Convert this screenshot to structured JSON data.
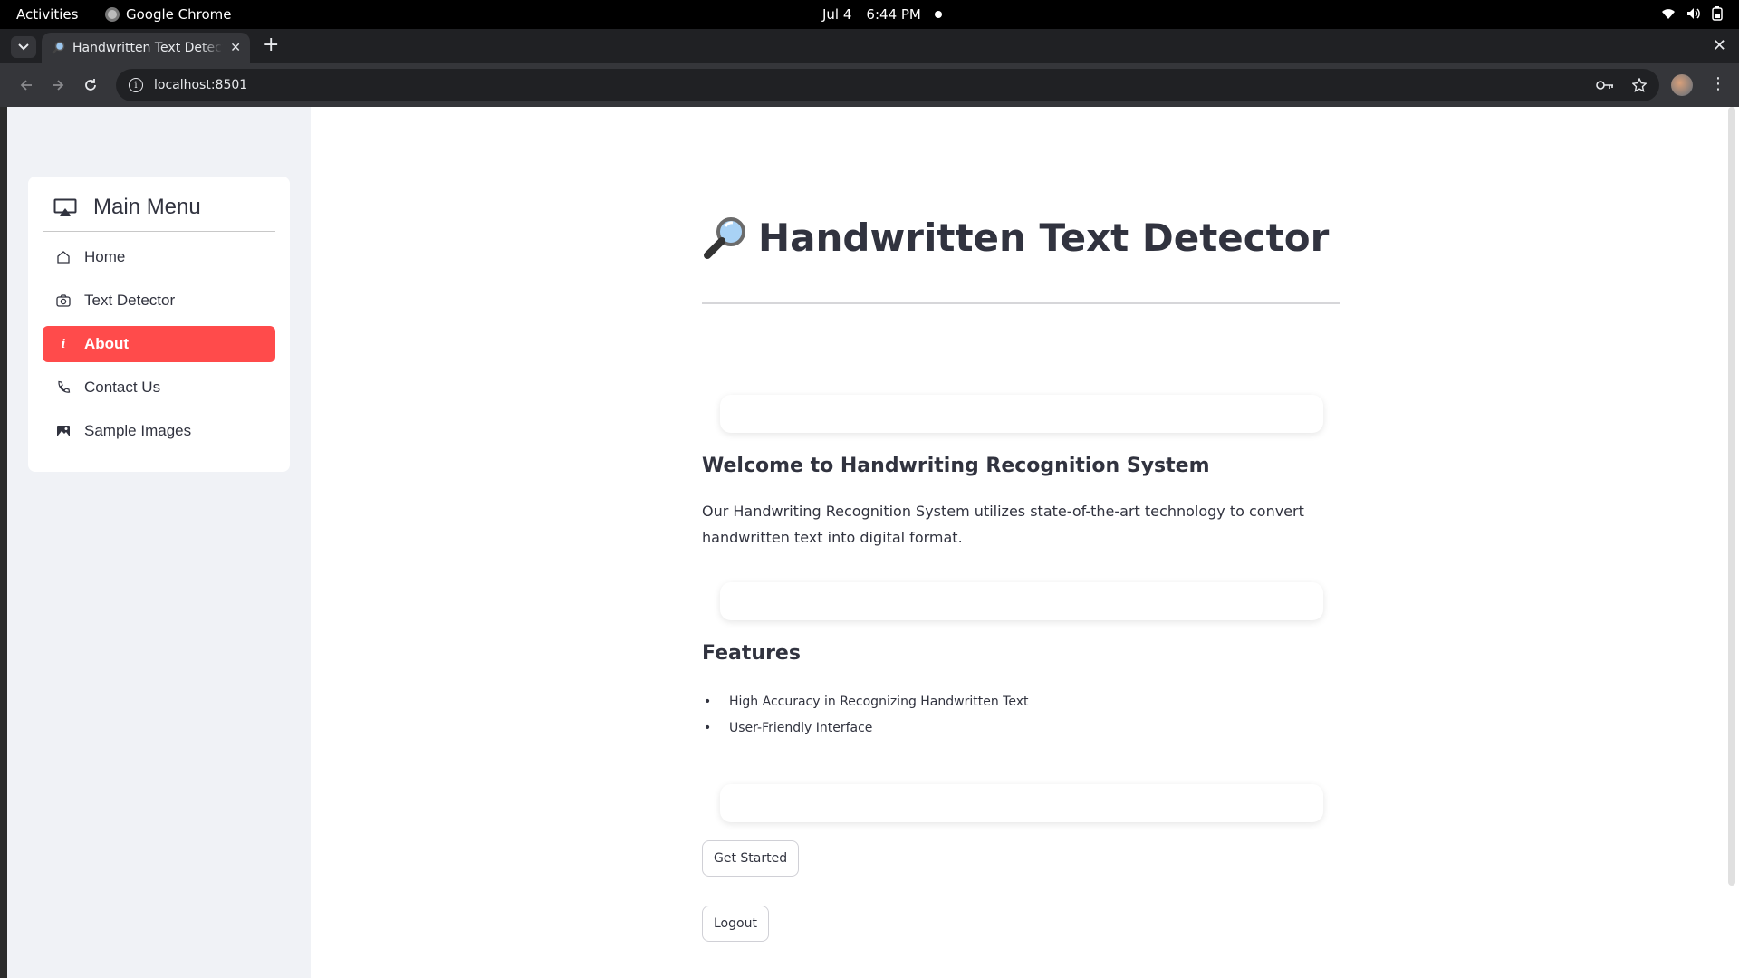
{
  "system_bar": {
    "activities": "Activities",
    "app_name": "Google Chrome",
    "date": "Jul 4",
    "time": "6:44 PM"
  },
  "browser": {
    "tab_title": "Handwritten Text Detector",
    "url": "localhost:8501"
  },
  "sidebar": {
    "menu_title": "Main Menu",
    "items": [
      {
        "label": "Home",
        "icon": "house-icon"
      },
      {
        "label": "Text Detector",
        "icon": "camera-icon"
      },
      {
        "label": "About",
        "icon": "info-icon",
        "active": true
      },
      {
        "label": "Contact Us",
        "icon": "phone-icon"
      },
      {
        "label": "Sample Images",
        "icon": "image-icon"
      }
    ]
  },
  "main": {
    "title": "Handwritten Text Detector",
    "title_icon": "magnifying-glass-icon",
    "welcome_heading": "Welcome to Handwriting Recognition System",
    "welcome_text": "Our Handwriting Recognition System utilizes state-of-the-art technology to convert handwritten text into digital format.",
    "features_heading": "Features",
    "features": [
      "High Accuracy in Recognizing Handwritten Text",
      "User-Friendly Interface"
    ],
    "get_started_label": "Get Started",
    "logout_label": "Logout"
  },
  "colors": {
    "accent": "#ff4b4b",
    "sidebar_bg": "#f0f2f6",
    "text": "#31333f"
  }
}
